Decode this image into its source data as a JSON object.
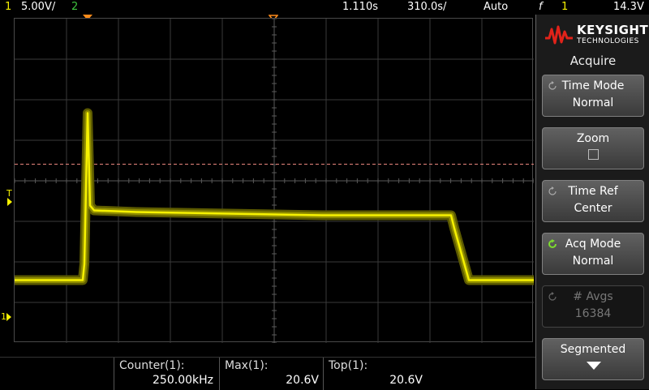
{
  "header": {
    "ch1_scale": "5.00V/",
    "ch1_num": "1",
    "ch2_num": "2",
    "time_delay": "1.110s",
    "time_scale": "310.0s/",
    "trigger_mode": "Auto",
    "trigger_slope_symbol": "f",
    "trigger_source": "1",
    "trigger_level": "14.3V"
  },
  "screen": {
    "trigger_label": "T",
    "ground_label": "1",
    "trace_color": "#f6f100",
    "trigger_line_color": "#e8857e",
    "trace": {
      "baseline_volts": 0.0,
      "peak_volts": 20.6,
      "plateau_volts": 8.4,
      "vertical_divisions": 8,
      "horizontal_divisions": 10
    }
  },
  "measurements": [
    {
      "label": "Counter(1):",
      "value": "250.00kHz"
    },
    {
      "label": "Max(1):",
      "value": "20.6V"
    },
    {
      "label": "Top(1):",
      "value": "20.6V"
    }
  ],
  "sidebar": {
    "brand": "KEYSIGHT",
    "brand_sub": "TECHNOLOGIES",
    "menu_title": "Acquire",
    "buttons": [
      {
        "label": "Time Mode",
        "value": "Normal",
        "icon": "rotate-icon",
        "enabled": true
      },
      {
        "label": "Zoom",
        "value": "",
        "icon": "checkbox-icon",
        "enabled": true
      },
      {
        "label": "Time Ref",
        "value": "Center",
        "icon": "rotate-icon",
        "enabled": true
      },
      {
        "label": "Acq Mode",
        "value": "Normal",
        "icon": "rotate-active-icon",
        "enabled": true
      },
      {
        "label": "# Avgs",
        "value": "16384",
        "icon": "rotate-icon",
        "enabled": false
      },
      {
        "label": "Segmented",
        "value": "",
        "icon": "down-arrow-icon",
        "enabled": true
      }
    ]
  }
}
